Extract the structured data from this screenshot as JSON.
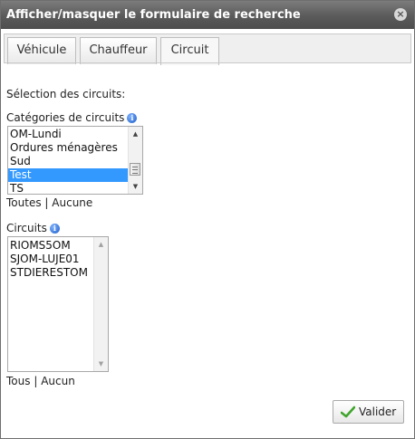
{
  "dialog": {
    "title": "Afficher/masquer le formulaire de recherche",
    "close_icon": "×"
  },
  "tabs": [
    {
      "label": "Véhicule",
      "active": false
    },
    {
      "label": "Chauffeur",
      "active": false
    },
    {
      "label": "Circuit",
      "active": true
    }
  ],
  "circuit_panel": {
    "section_title": "Sélection des circuits:",
    "categories_label": "Catégories de circuits",
    "categories": [
      {
        "label": "OM-Lundi",
        "selected": false
      },
      {
        "label": "Ordures ménagères",
        "selected": false
      },
      {
        "label": "Sud",
        "selected": false
      },
      {
        "label": "Test",
        "selected": true
      },
      {
        "label": "TS",
        "selected": false
      }
    ],
    "categories_all": "Toutes",
    "categories_none": "Aucune",
    "circuits_label": "Circuits",
    "circuits": [
      {
        "label": "RIOMS5OM"
      },
      {
        "label": "SJOM-LUJE01"
      },
      {
        "label": "STDIERESTOM"
      }
    ],
    "circuits_all": "Tous",
    "circuits_none": "Aucun",
    "separator": "|"
  },
  "footer": {
    "submit_label": "Valider"
  },
  "colors": {
    "titlebar": "#5a5a5a",
    "selection": "#3399ff",
    "check_icon": "#3fa52b"
  }
}
